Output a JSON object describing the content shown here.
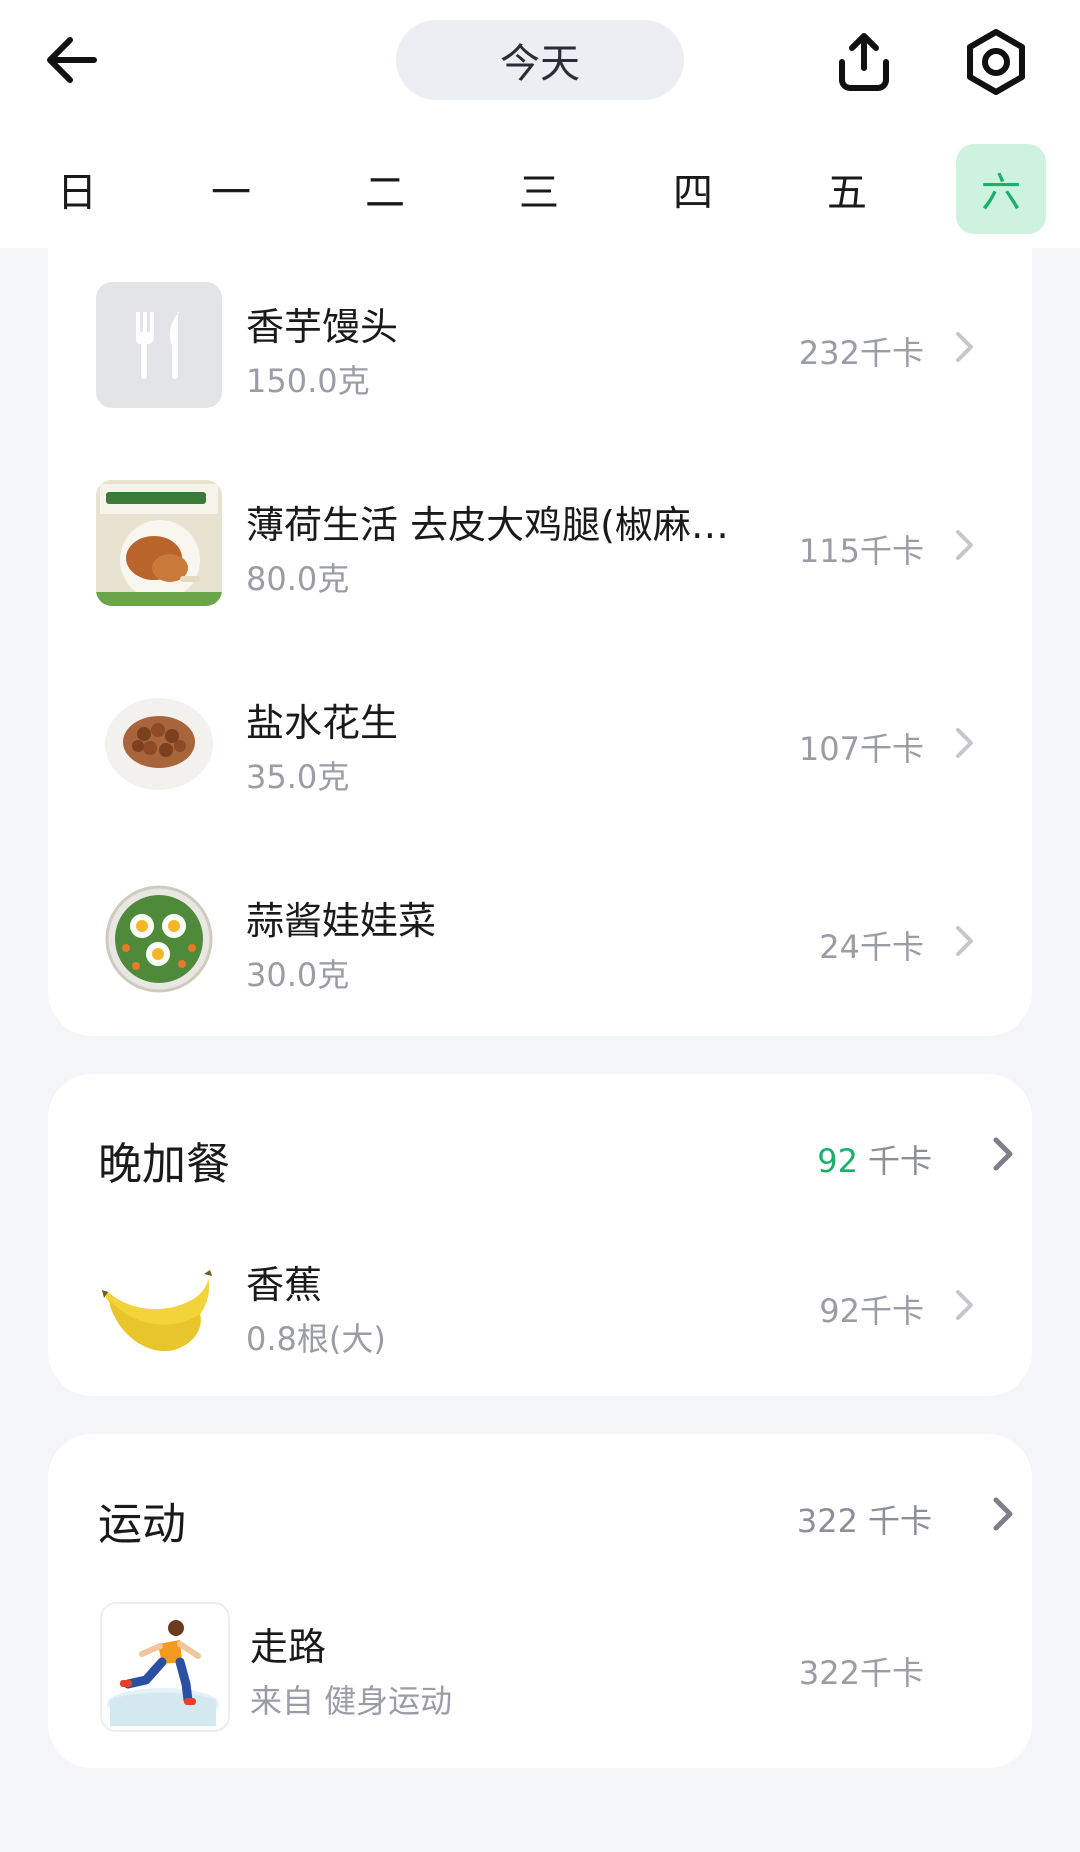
{
  "header": {
    "today_label": "今天",
    "week_days": [
      "日",
      "一",
      "二",
      "三",
      "四",
      "五",
      "六"
    ],
    "active_day_index": 6
  },
  "meal_items": [
    {
      "name": "香芋馒头",
      "quantity": "150.0克",
      "kcal": "232千卡",
      "icon": "fork-knife-placeholder-icon"
    },
    {
      "name": "薄荷生活 去皮大鸡腿(椒麻…",
      "quantity": "80.0克",
      "kcal": "115千卡",
      "icon": "chicken-leg-package-photo"
    },
    {
      "name": "盐水花生",
      "quantity": "35.0克",
      "kcal": "107千卡",
      "icon": "peanuts-plate-photo"
    },
    {
      "name": "蒜酱娃娃菜",
      "quantity": "30.0克",
      "kcal": "24千卡",
      "icon": "salad-plate-photo"
    }
  ],
  "late_snack": {
    "title": "晚加餐",
    "kcal_value": "92",
    "kcal_unit": "千卡",
    "items": [
      {
        "name": "香蕉",
        "quantity": "0.8根(大)",
        "kcal": "92千卡",
        "icon": "banana-photo"
      }
    ]
  },
  "exercise": {
    "title": "运动",
    "kcal_value": "322",
    "kcal_unit": "千卡",
    "items": [
      {
        "name": "走路",
        "quantity": "来自 健身运动",
        "kcal": "322千卡",
        "icon": "running-man-icon"
      }
    ]
  },
  "colors": {
    "accent": "#1bb06a",
    "active_day_bg": "#cdf3e0",
    "page_bg": "#f4f5f9"
  }
}
